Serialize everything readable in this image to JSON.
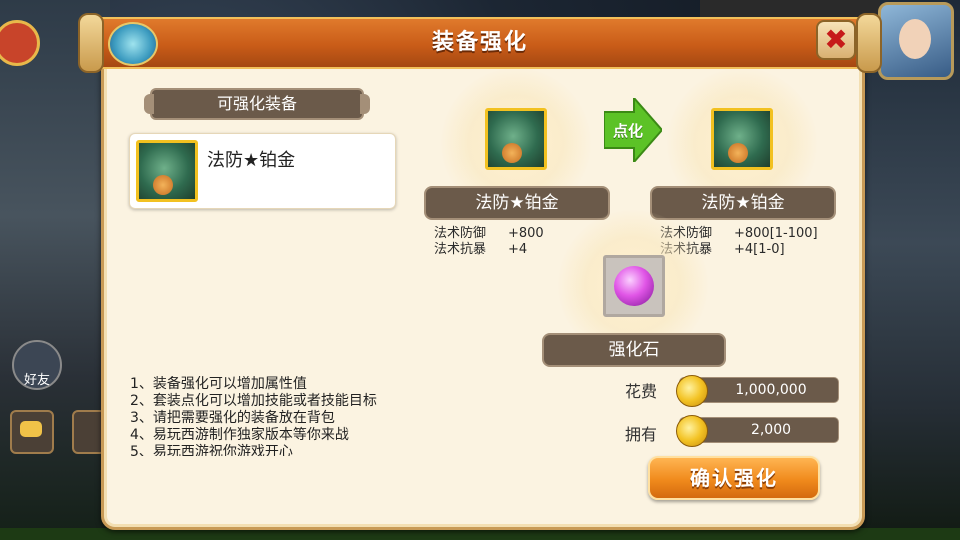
{
  "dialog": {
    "title": "装备强化",
    "close_label": "✖"
  },
  "left_panel": {
    "section_title": "可强化装备",
    "equipment_list": [
      {
        "name": "法防★铂金"
      }
    ]
  },
  "current_item": {
    "name": "法防★铂金",
    "stats": [
      {
        "label": "法术防御",
        "value": "+800"
      },
      {
        "label": "法术抗暴",
        "value": "+4"
      }
    ]
  },
  "upgrade_arrow": {
    "label": "点化"
  },
  "result_item": {
    "name": "法防★铂金",
    "stats": [
      {
        "label": "法术防御",
        "value": "+800[1-100]"
      },
      {
        "label": "法术抗暴",
        "value": "+4[1-0]"
      }
    ]
  },
  "material": {
    "name": "强化石"
  },
  "tips": [
    "1、装备强化可以增加属性值",
    "2、套装点化可以增加技能或者技能目标",
    "3、请把需要强化的装备放在背包",
    "4、易玩西游制作独家版本等你来战",
    "5、易玩西游祝你游戏开心"
  ],
  "cost": {
    "cost_label": "花费",
    "cost_value": "1,000,000",
    "owned_label": "拥有",
    "owned_value": "2,000"
  },
  "confirm_button": {
    "label": "确认强化"
  },
  "hud": {
    "friend_label": "好友"
  },
  "colors": {
    "title_ribbon": "#d9671f",
    "panel_bg": "#fbf3e1",
    "plate_bg": "#6b5a4a",
    "confirm": "#f08a1c",
    "slot_border_gold": "#f2c120",
    "arrow": "#5cc227"
  },
  "icons": {
    "equipment": "jade-pendant-icon",
    "material": "purple-orb-icon",
    "currency": "gold-coin-icon",
    "close": "close-x-icon"
  }
}
